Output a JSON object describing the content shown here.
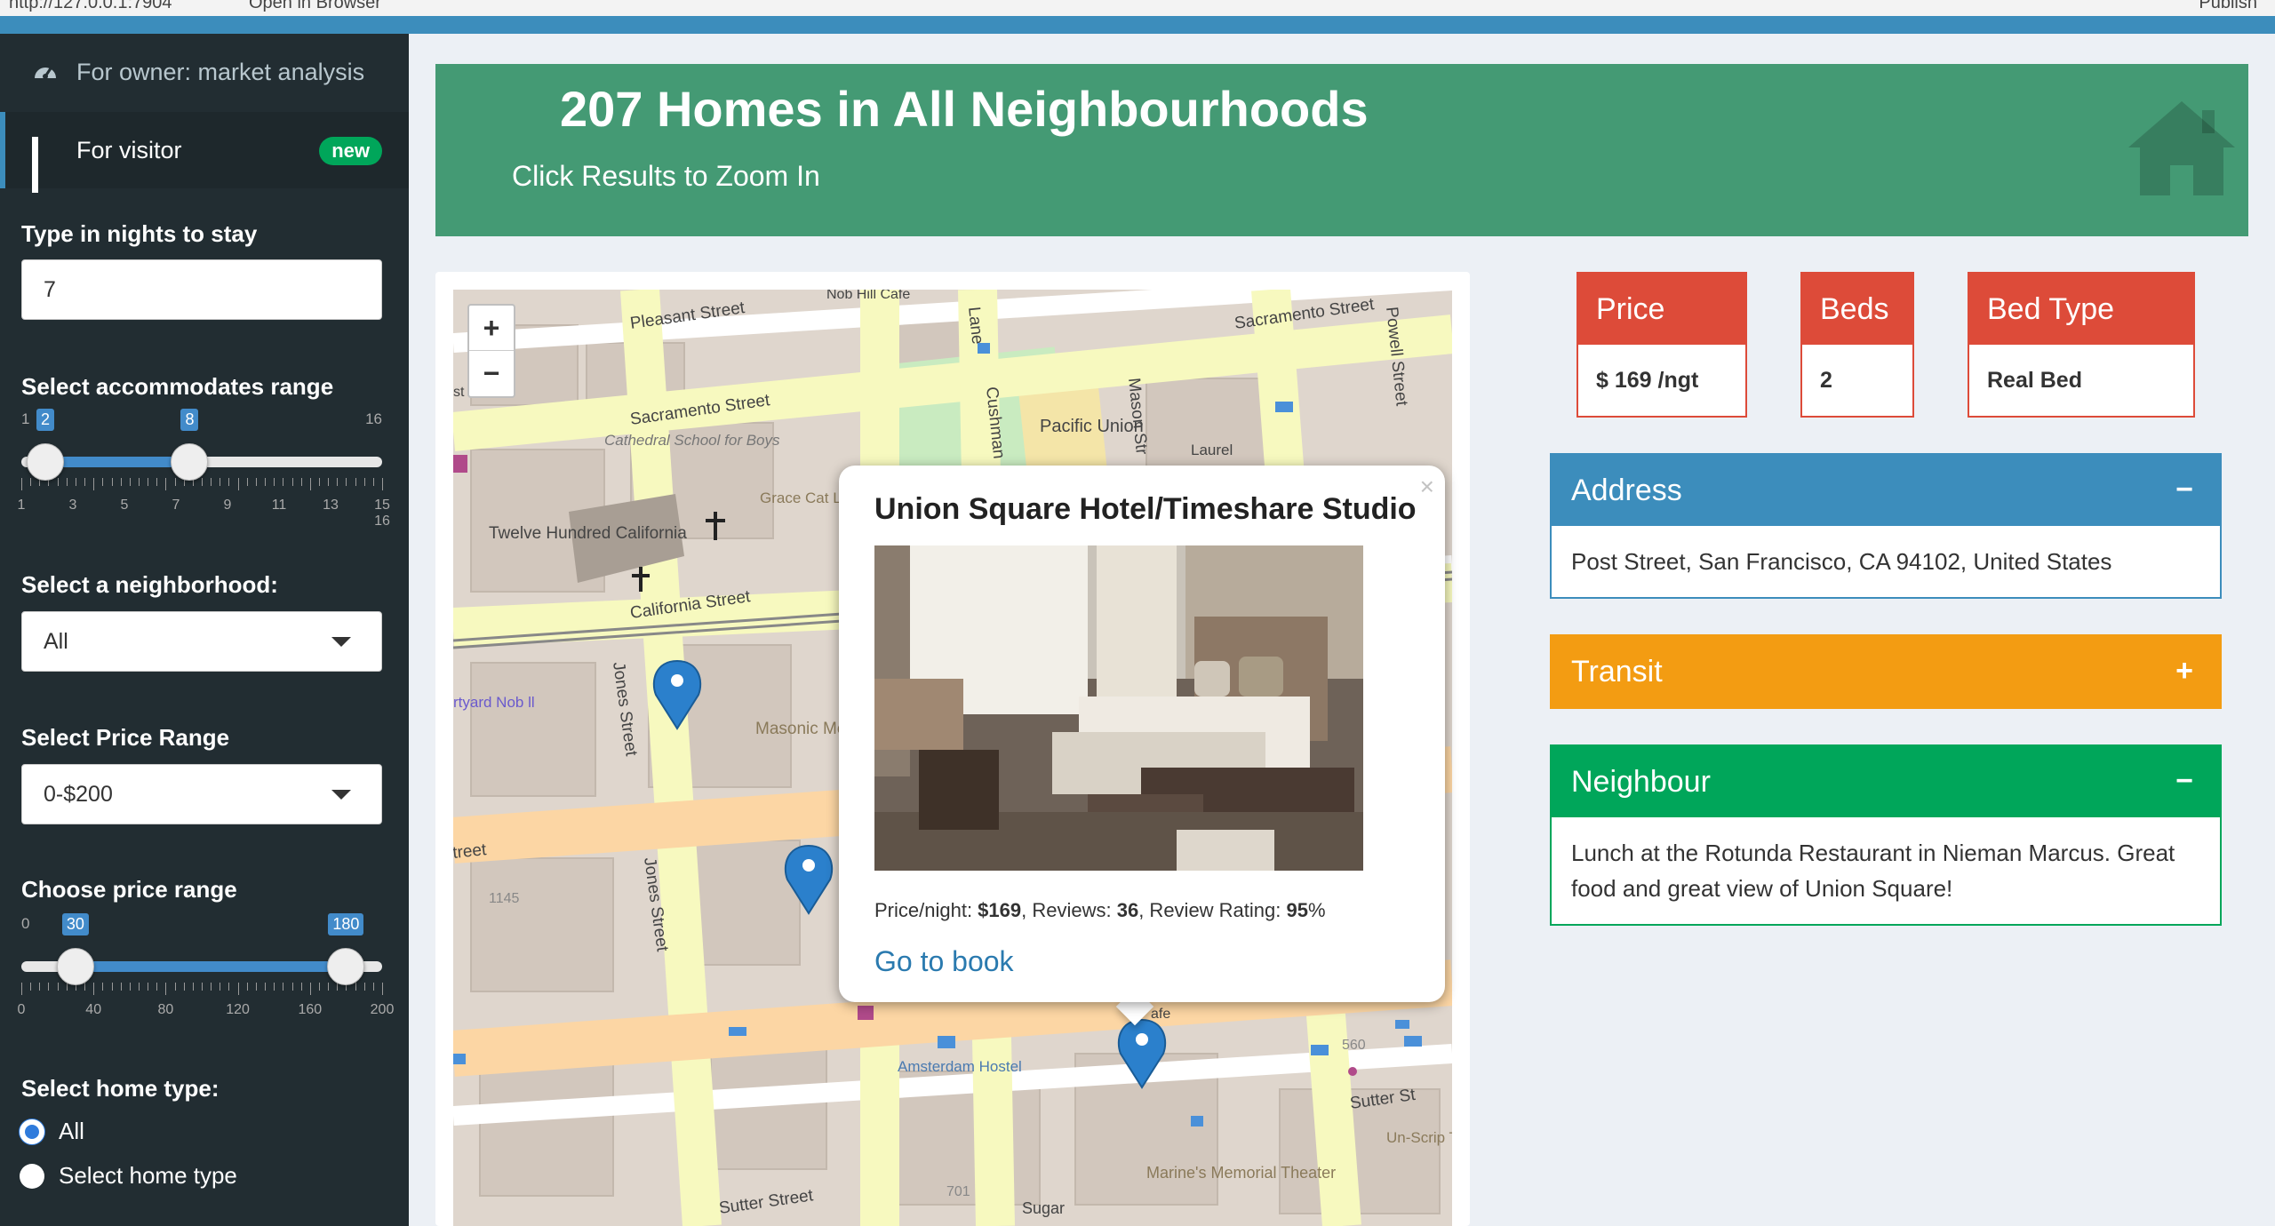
{
  "browser": {
    "url": "http://127.0.0.1:7904",
    "open_label": "Open in Browser",
    "publish_label": "Publish"
  },
  "sidebar": {
    "menu": [
      {
        "label": "For owner: market analysis",
        "icon": "dashboard-icon"
      },
      {
        "label": "For visitor",
        "icon": "grid-icon",
        "badge": "new"
      }
    ],
    "nights": {
      "label": "Type in nights to stay",
      "value": "7"
    },
    "accommodates": {
      "label": "Select accommodates range",
      "min": 1,
      "max": 16,
      "from": 2,
      "to": 8,
      "min_label": "1",
      "max_label": "16",
      "tick_labels": [
        "1",
        "3",
        "5",
        "7",
        "9",
        "11",
        "13",
        "15 16"
      ]
    },
    "neighborhood": {
      "label": "Select a neighborhood:",
      "value": "All"
    },
    "price_select": {
      "label": "Select Price Range",
      "value": "0-$200"
    },
    "price_slider": {
      "label": "Choose price range",
      "min": 0,
      "max": 200,
      "from": 30,
      "to": 180,
      "min_label": "0",
      "tick_labels": [
        "0",
        "40",
        "80",
        "120",
        "160",
        "200"
      ]
    },
    "home_type": {
      "label": "Select home type:",
      "options": [
        {
          "label": "All",
          "selected": true
        },
        {
          "label": "Select home type",
          "selected": false
        }
      ]
    }
  },
  "header": {
    "title": "207 Homes in All Neighbourhoods",
    "subtitle": "Click Results to Zoom In",
    "icon": "home-icon",
    "color": "#449a74"
  },
  "map": {
    "zoom_in": "+",
    "zoom_out": "−",
    "street_labels": {
      "pleasant": "Pleasant Street",
      "sacramento_w": "Sacramento Street",
      "sacramento_e": "Sacramento Street",
      "california": "California Street",
      "jones1": "Jones Street",
      "jones2": "Jones Street",
      "sutter": "Sutter Street",
      "sutter_e": "Sutter St",
      "street_w": "treet",
      "mason": "Mason Str",
      "powell": "Powell Street",
      "lane": "Lane",
      "cushman": "Cushman"
    },
    "poi_labels": {
      "nob_hill": "Nob Hill Cafe",
      "cathedral": "Cathedral School for Boys",
      "grace": "Grace Cat Labyri",
      "pacific": "Pacific Union",
      "laurel": "Laurel",
      "twelve": "Twelve Hundred California",
      "masonic": "Masonic Memorial Temple",
      "yard": "rtyard Nob ll",
      "amsterdam": "Amsterdam Hostel",
      "marines": "Marine's Memorial Theater",
      "sugar": "Sugar",
      "unscrip": "Un-Scrip Theat Compa",
      "n1145": "1145",
      "n560": "560",
      "n701": "701",
      "cafe": "afe",
      "st": "st nk"
    }
  },
  "popup": {
    "close": "×",
    "title": "Union Square Hotel/Timeshare Studio",
    "price_label": "Price/night: ",
    "price": "$169",
    "reviews_label": ", Reviews: ",
    "reviews": "36",
    "rating_label": ", Review Rating: ",
    "rating": "95",
    "rating_unit": "%",
    "link": "Go to book"
  },
  "value_boxes": [
    {
      "label": "Price",
      "value": "$ 169 /ngt"
    },
    {
      "label": "Beds",
      "value": "2"
    },
    {
      "label": "Bed Type",
      "value": "Real Bed"
    }
  ],
  "panels": {
    "address": {
      "title": "Address",
      "toggle": "−",
      "body": "Post Street, San Francisco, CA 94102, United States",
      "color": "#3c8dbc"
    },
    "transit": {
      "title": "Transit",
      "toggle": "+",
      "color": "#f39c12"
    },
    "neighbour": {
      "title": "Neighbour",
      "toggle": "−",
      "body": "Lunch at the Rotunda Restaurant in Nieman Marcus. Great food and great view of Union Square!",
      "color": "#00a65a"
    }
  }
}
